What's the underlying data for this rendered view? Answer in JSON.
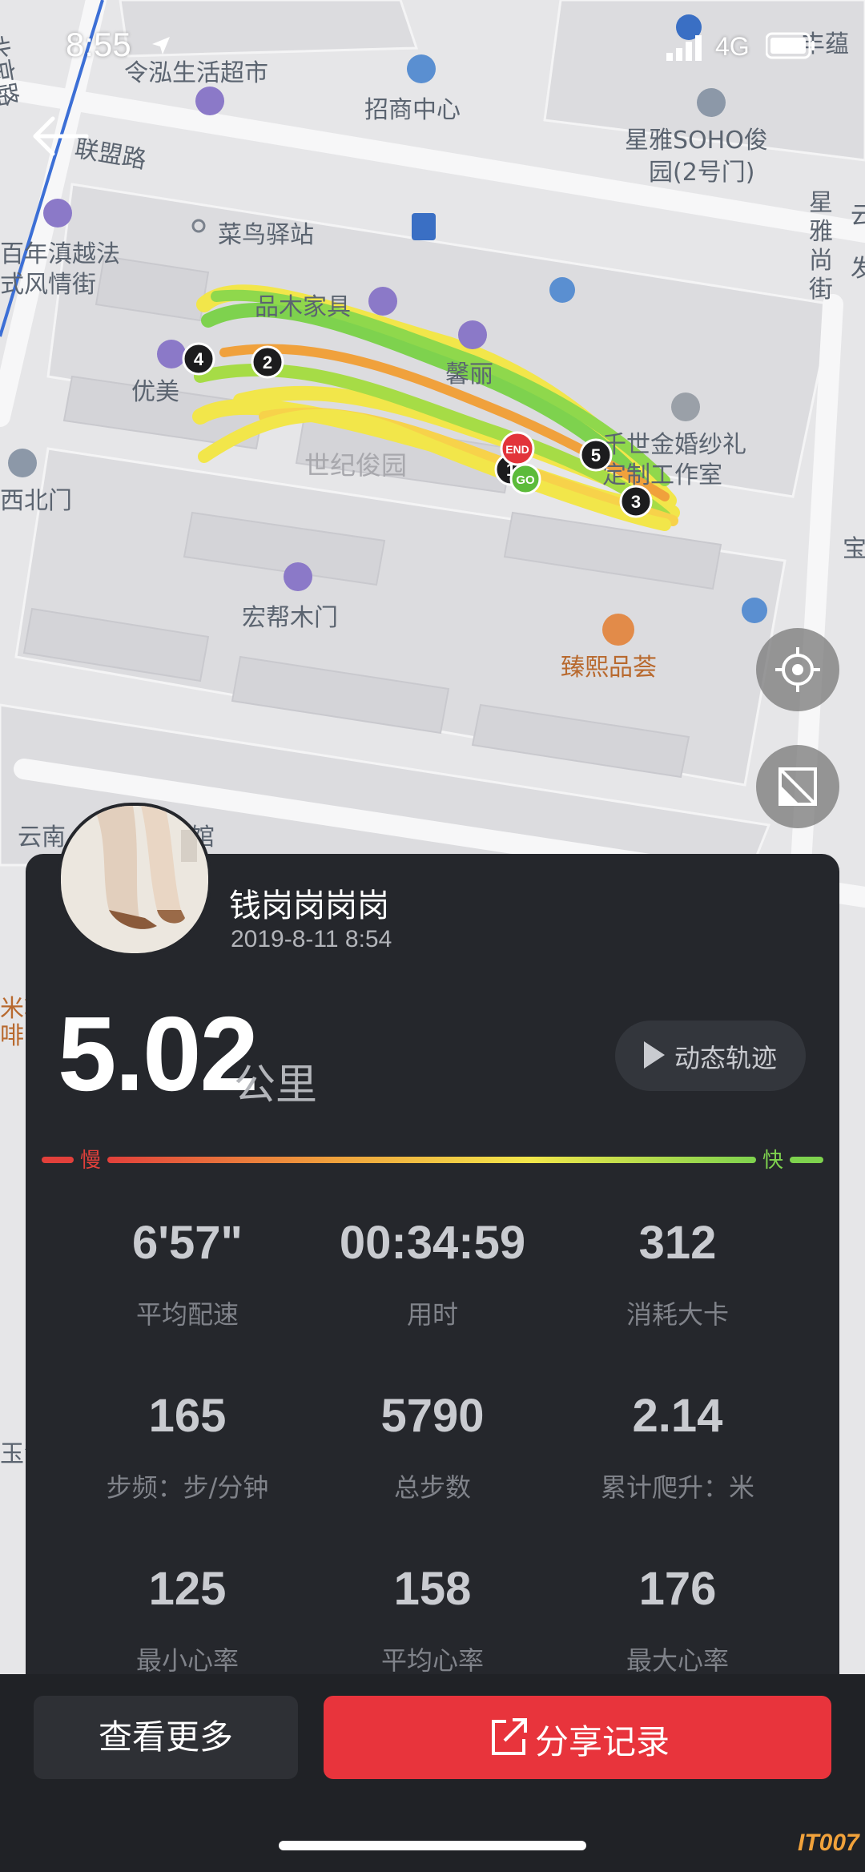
{
  "status_bar": {
    "time": "8:55",
    "network": "4G"
  },
  "map": {
    "labels": [
      "北京路",
      "令泓生活超市",
      "招商中心",
      "星雅SOHO俊",
      "园(2号门)",
      "联盟路",
      "菜鸟驿站",
      "百年滇越法",
      "式风情街",
      "品木家具",
      "馨丽",
      "优美",
      "千世金婚纱礼",
      "定制工作室",
      "世纪俊园",
      "宏帮木门",
      "臻熙品荟",
      "西北门",
      "云南",
      "馆",
      "星雅尚街",
      "丰蕴",
      "云",
      "发",
      "宝",
      "米软",
      "啡",
      "玉溪路"
    ],
    "markers": {
      "end": "END",
      "go": "GO",
      "km": [
        "1",
        "2",
        "3",
        "4",
        "5"
      ]
    }
  },
  "colors": {
    "panel": "#25272c",
    "accent": "#e8343c",
    "slow": "#e2403b",
    "fast": "#7ed24e",
    "route_fast": "#7ed24e",
    "route_mid": "#f2e64a",
    "route_slow": "#f0a13c"
  },
  "icons": [
    "back-arrow-icon",
    "locate-icon",
    "map-layer-icon",
    "play-icon",
    "share-icon"
  ],
  "user": {
    "name": "钱岗岗岗岗",
    "date": "2019-8-11 8:54"
  },
  "distance": {
    "value": "5.02",
    "unit": "公里"
  },
  "replay_label": "动态轨迹",
  "speed_legend": {
    "slow": "慢",
    "fast": "快"
  },
  "stats": [
    {
      "value": "6'57\"",
      "label": "平均配速"
    },
    {
      "value": "00:34:59",
      "label": "用时"
    },
    {
      "value": "312",
      "label": "消耗大卡"
    },
    {
      "value": "165",
      "label": "步频：步/分钟"
    },
    {
      "value": "5790",
      "label": "总步数"
    },
    {
      "value": "2.14",
      "label": "累计爬升：米"
    },
    {
      "value": "125",
      "label": "最小心率"
    },
    {
      "value": "158",
      "label": "平均心率"
    },
    {
      "value": "176",
      "label": "最大心率"
    }
  ],
  "actions": {
    "more": "查看更多",
    "share": "分享记录"
  },
  "watermark": "IT007"
}
